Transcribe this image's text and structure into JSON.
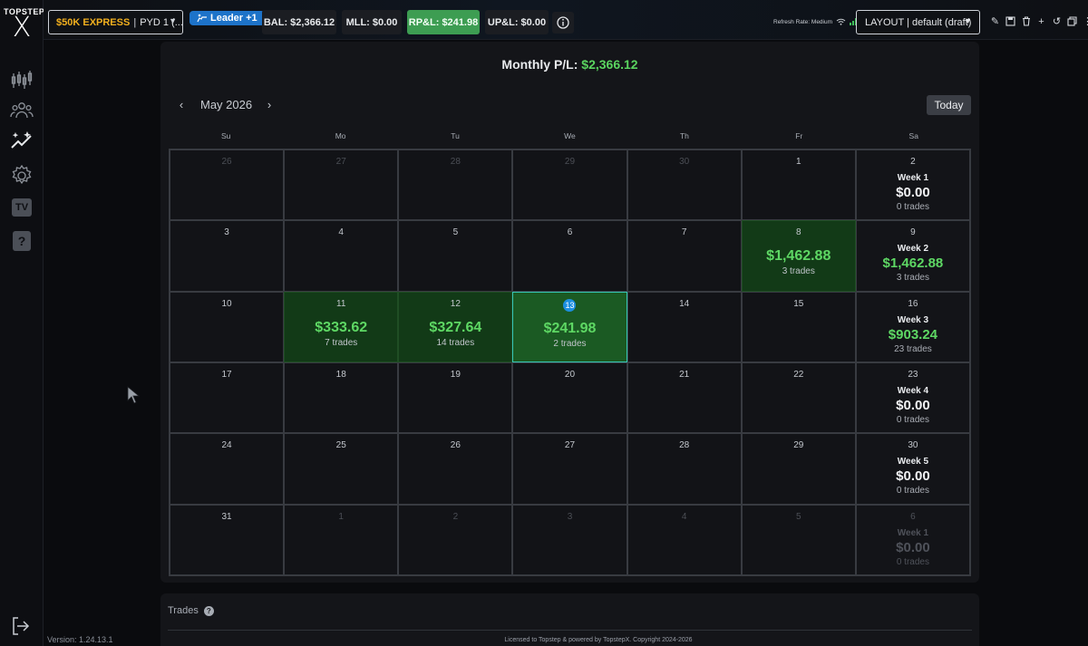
{
  "brand": {
    "line1": "TOPSTEP",
    "line2": "X"
  },
  "account": {
    "name": "$50K EXPRESS",
    "sep": "|",
    "sub": "PYD 1 (..."
  },
  "leader_label": "Leader +1",
  "stats": {
    "bal": "BAL: $2,366.12",
    "mll": "MLL: $0.00",
    "rpl": "RP&L: $241.98",
    "upl": "UP&L: $0.00"
  },
  "refresh_rate": "Refresh Rate: Medium",
  "layout_label": "LAYOUT | default (draft)",
  "monthly": {
    "label": "Monthly P/L:",
    "value": "$2,366.12"
  },
  "calendar": {
    "month": "May 2026",
    "prev_icon": "‹",
    "next_icon": "›",
    "today_label": "Today",
    "weekdays": [
      "Su",
      "Mo",
      "Tu",
      "We",
      "Th",
      "Fr",
      "Sa"
    ],
    "weeks": [
      {
        "days": [
          {
            "d": "26",
            "other": true
          },
          {
            "d": "27",
            "other": true
          },
          {
            "d": "28",
            "other": true
          },
          {
            "d": "29",
            "other": true
          },
          {
            "d": "30",
            "other": true
          },
          {
            "d": "1"
          }
        ],
        "summary": {
          "d": "2",
          "label": "Week 1",
          "pl": "$0.00",
          "trades": "0 trades",
          "green": false
        }
      },
      {
        "days": [
          {
            "d": "3"
          },
          {
            "d": "4"
          },
          {
            "d": "5"
          },
          {
            "d": "6"
          },
          {
            "d": "7"
          },
          {
            "d": "8",
            "pl": "$1,462.88",
            "trades": "3 trades"
          }
        ],
        "summary": {
          "d": "9",
          "label": "Week 2",
          "pl": "$1,462.88",
          "trades": "3 trades",
          "green": true
        }
      },
      {
        "days": [
          {
            "d": "10"
          },
          {
            "d": "11",
            "pl": "$333.62",
            "trades": "7 trades"
          },
          {
            "d": "12",
            "pl": "$327.64",
            "trades": "14 trades"
          },
          {
            "d": "13",
            "pl": "$241.98",
            "trades": "2 trades",
            "today": true
          },
          {
            "d": "14"
          },
          {
            "d": "15"
          }
        ],
        "summary": {
          "d": "16",
          "label": "Week 3",
          "pl": "$903.24",
          "trades": "23 trades",
          "green": true
        }
      },
      {
        "days": [
          {
            "d": "17"
          },
          {
            "d": "18"
          },
          {
            "d": "19"
          },
          {
            "d": "20"
          },
          {
            "d": "21"
          },
          {
            "d": "22"
          }
        ],
        "summary": {
          "d": "23",
          "label": "Week 4",
          "pl": "$0.00",
          "trades": "0 trades",
          "green": false
        }
      },
      {
        "days": [
          {
            "d": "24"
          },
          {
            "d": "25"
          },
          {
            "d": "26"
          },
          {
            "d": "27"
          },
          {
            "d": "28"
          },
          {
            "d": "29"
          }
        ],
        "summary": {
          "d": "30",
          "label": "Week 5",
          "pl": "$0.00",
          "trades": "0 trades",
          "green": false
        }
      },
      {
        "days": [
          {
            "d": "31"
          },
          {
            "d": "1",
            "other": true
          },
          {
            "d": "2",
            "other": true
          },
          {
            "d": "3",
            "other": true
          },
          {
            "d": "4",
            "other": true
          },
          {
            "d": "5",
            "other": true
          }
        ],
        "summary": {
          "d": "6",
          "label": "Week 1",
          "pl": "$0.00",
          "trades": "0 trades",
          "green": false,
          "dim": true
        }
      }
    ]
  },
  "trades_section": {
    "title": "Trades",
    "help_icon": "?"
  },
  "footer": {
    "version": "Version: 1.24.13.1",
    "license": "Licensed to Topstep & powered by TopstepX. Copyright 2024-2026"
  },
  "sidebar": {
    "icons": [
      "candlestick-chart-icon",
      "users-group-icon",
      "sparkle-trend-icon",
      "settings-gear-icon",
      "tv-icon",
      "help-icon",
      "logout-icon"
    ],
    "tv_label": "TV",
    "help_label": "?"
  },
  "colors": {
    "profit": "#5ad45f",
    "accent_orange": "#f2b01e",
    "today_ring": "#37c6b6",
    "today_dot": "#1c8fe0",
    "leader_blue": "#1d73c9",
    "rpl_green": "#3d9d52"
  },
  "caret_icon": "▼"
}
